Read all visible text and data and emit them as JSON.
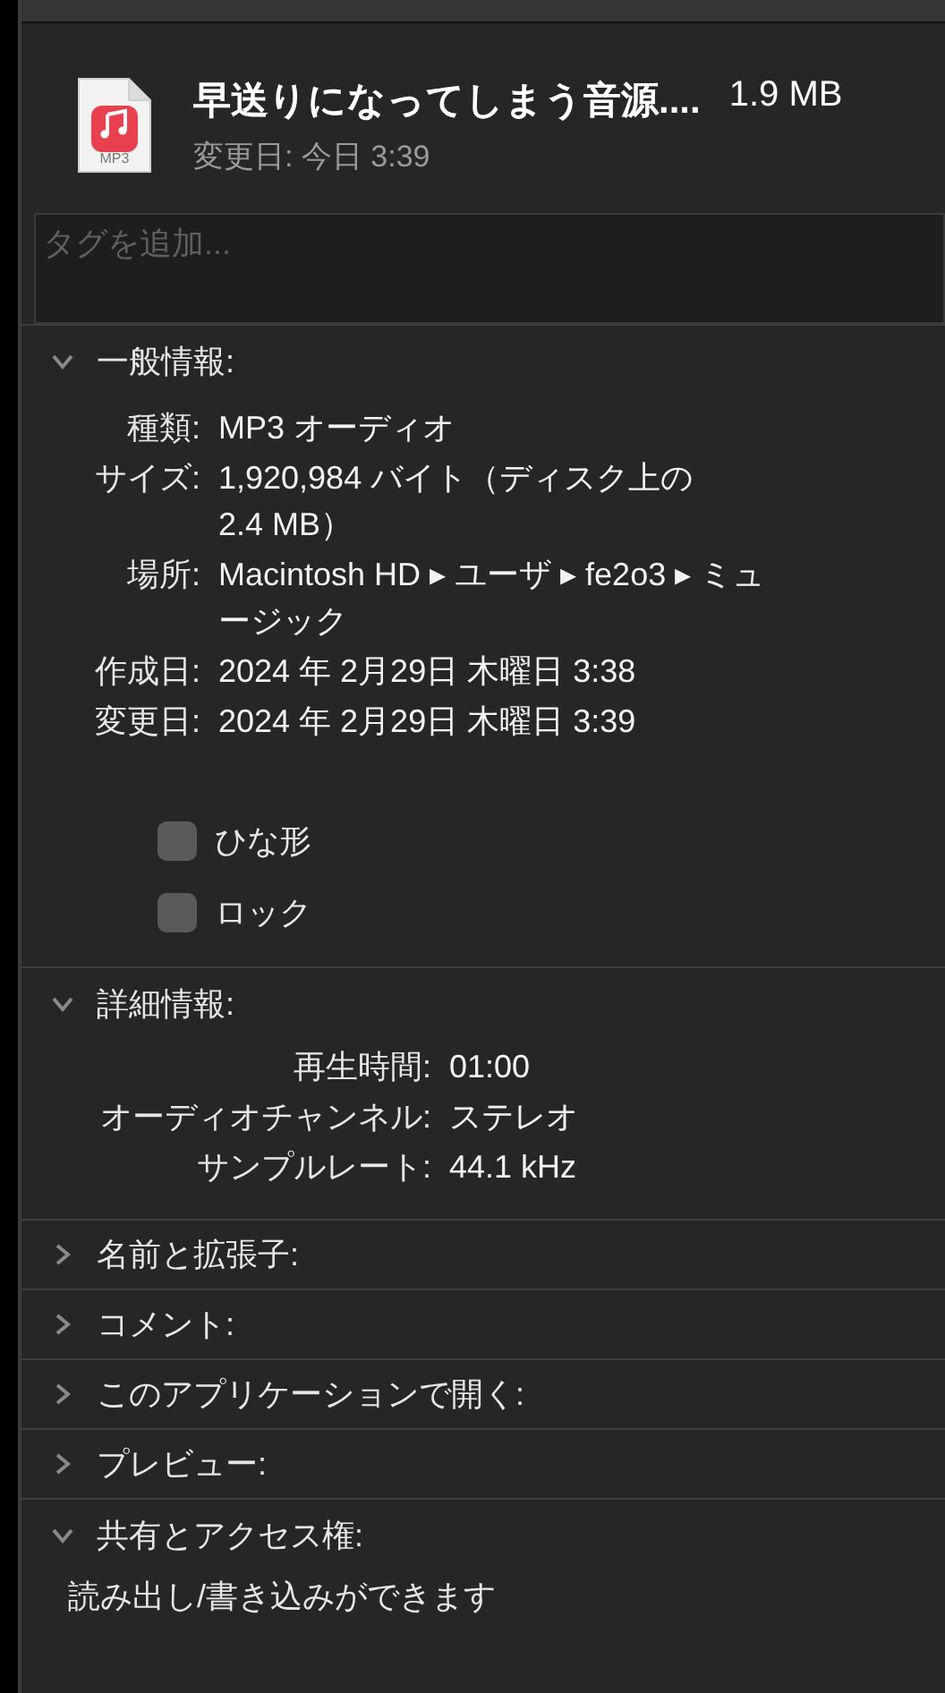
{
  "header": {
    "file_type_label": "MP3",
    "title": "早送りになってしまう音源....",
    "size": "1.9 MB",
    "modified": "変更日: 今日 3:39"
  },
  "tags": {
    "placeholder": "タグを追加..."
  },
  "sections": [
    {
      "kind": "general",
      "title": "一般情報:",
      "expanded": true,
      "rows": [
        {
          "label": "種類:",
          "value_lines": [
            "MP3 オーディオ"
          ]
        },
        {
          "label": "サイズ:",
          "value_lines": [
            "1,920,984 バイト（ディスク上の",
            "2.4 MB）"
          ]
        },
        {
          "label": "場所:",
          "value_lines": [
            "Macintosh HD ▸ ユーザ ▸ fe2o3 ▸ ミュ",
            "ージック"
          ]
        },
        {
          "label": "作成日:",
          "value_lines": [
            "2024 年 2月29日 木曜日 3:38"
          ]
        },
        {
          "label": "変更日:",
          "value_lines": [
            "2024 年 2月29日 木曜日 3:39"
          ]
        }
      ],
      "checkboxes": [
        {
          "label": "ひな形",
          "checked": false
        },
        {
          "label": "ロック",
          "checked": false
        }
      ]
    },
    {
      "kind": "details",
      "title": "詳細情報:",
      "expanded": true,
      "rows": [
        {
          "label": "再生時間:",
          "value": "01:00"
        },
        {
          "label": "オーディオチャンネル:",
          "value": "ステレオ"
        },
        {
          "label": "サンプルレート:",
          "value": "44.1 kHz"
        }
      ]
    },
    {
      "kind": "plain",
      "title": "名前と拡張子:",
      "expanded": false
    },
    {
      "kind": "plain",
      "title": "コメント:",
      "expanded": false
    },
    {
      "kind": "plain",
      "title": "このアプリケーションで開く:",
      "expanded": false
    },
    {
      "kind": "plain",
      "title": "プレビュー:",
      "expanded": false
    },
    {
      "kind": "sharing",
      "title": "共有とアクセス権:",
      "expanded": true,
      "text": "読み出し/書き込みができます"
    }
  ]
}
